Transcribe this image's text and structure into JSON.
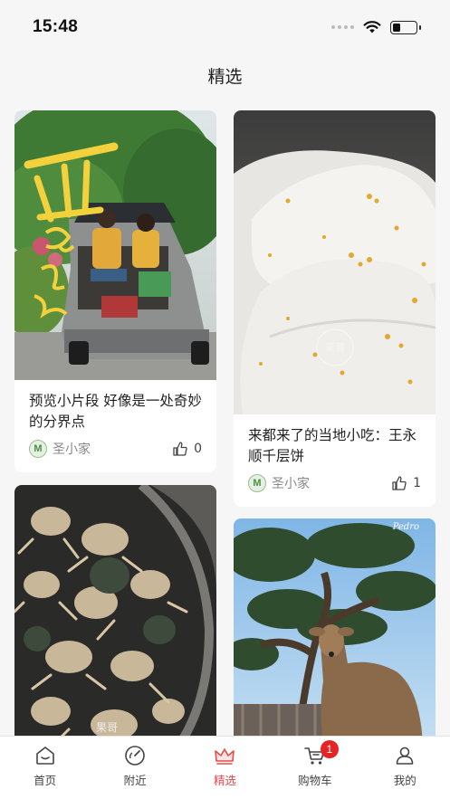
{
  "status_bar": {
    "time": "15:48"
  },
  "page": {
    "title": "精选"
  },
  "feed": [
    {
      "title": "预览小片段 好像是一处奇妙的分界点",
      "author": "圣小家",
      "likes": "0",
      "image": "couple-car-trunk-photo"
    },
    {
      "title": "来都来了的当地小吃：王永顺千层饼",
      "author": "圣小家",
      "likes": "1",
      "image": "osmanthus-rice-cake-photo"
    },
    {
      "title": "",
      "author": "",
      "likes": "",
      "image": "crabs-basket-photo"
    },
    {
      "title": "",
      "author": "",
      "likes": "",
      "image": "deer-tree-photo"
    }
  ],
  "tabs": [
    {
      "label": "首页",
      "icon": "home-icon",
      "active": false
    },
    {
      "label": "附近",
      "icon": "compass-icon",
      "active": false
    },
    {
      "label": "精选",
      "icon": "crown-icon",
      "active": true
    },
    {
      "label": "购物车",
      "icon": "cart-icon",
      "active": false,
      "badge": "1"
    },
    {
      "label": "我的",
      "icon": "user-icon",
      "active": false
    }
  ],
  "colors": {
    "accent": "#e64b4b",
    "badge": "#e52424",
    "background": "#f6f6f6"
  }
}
